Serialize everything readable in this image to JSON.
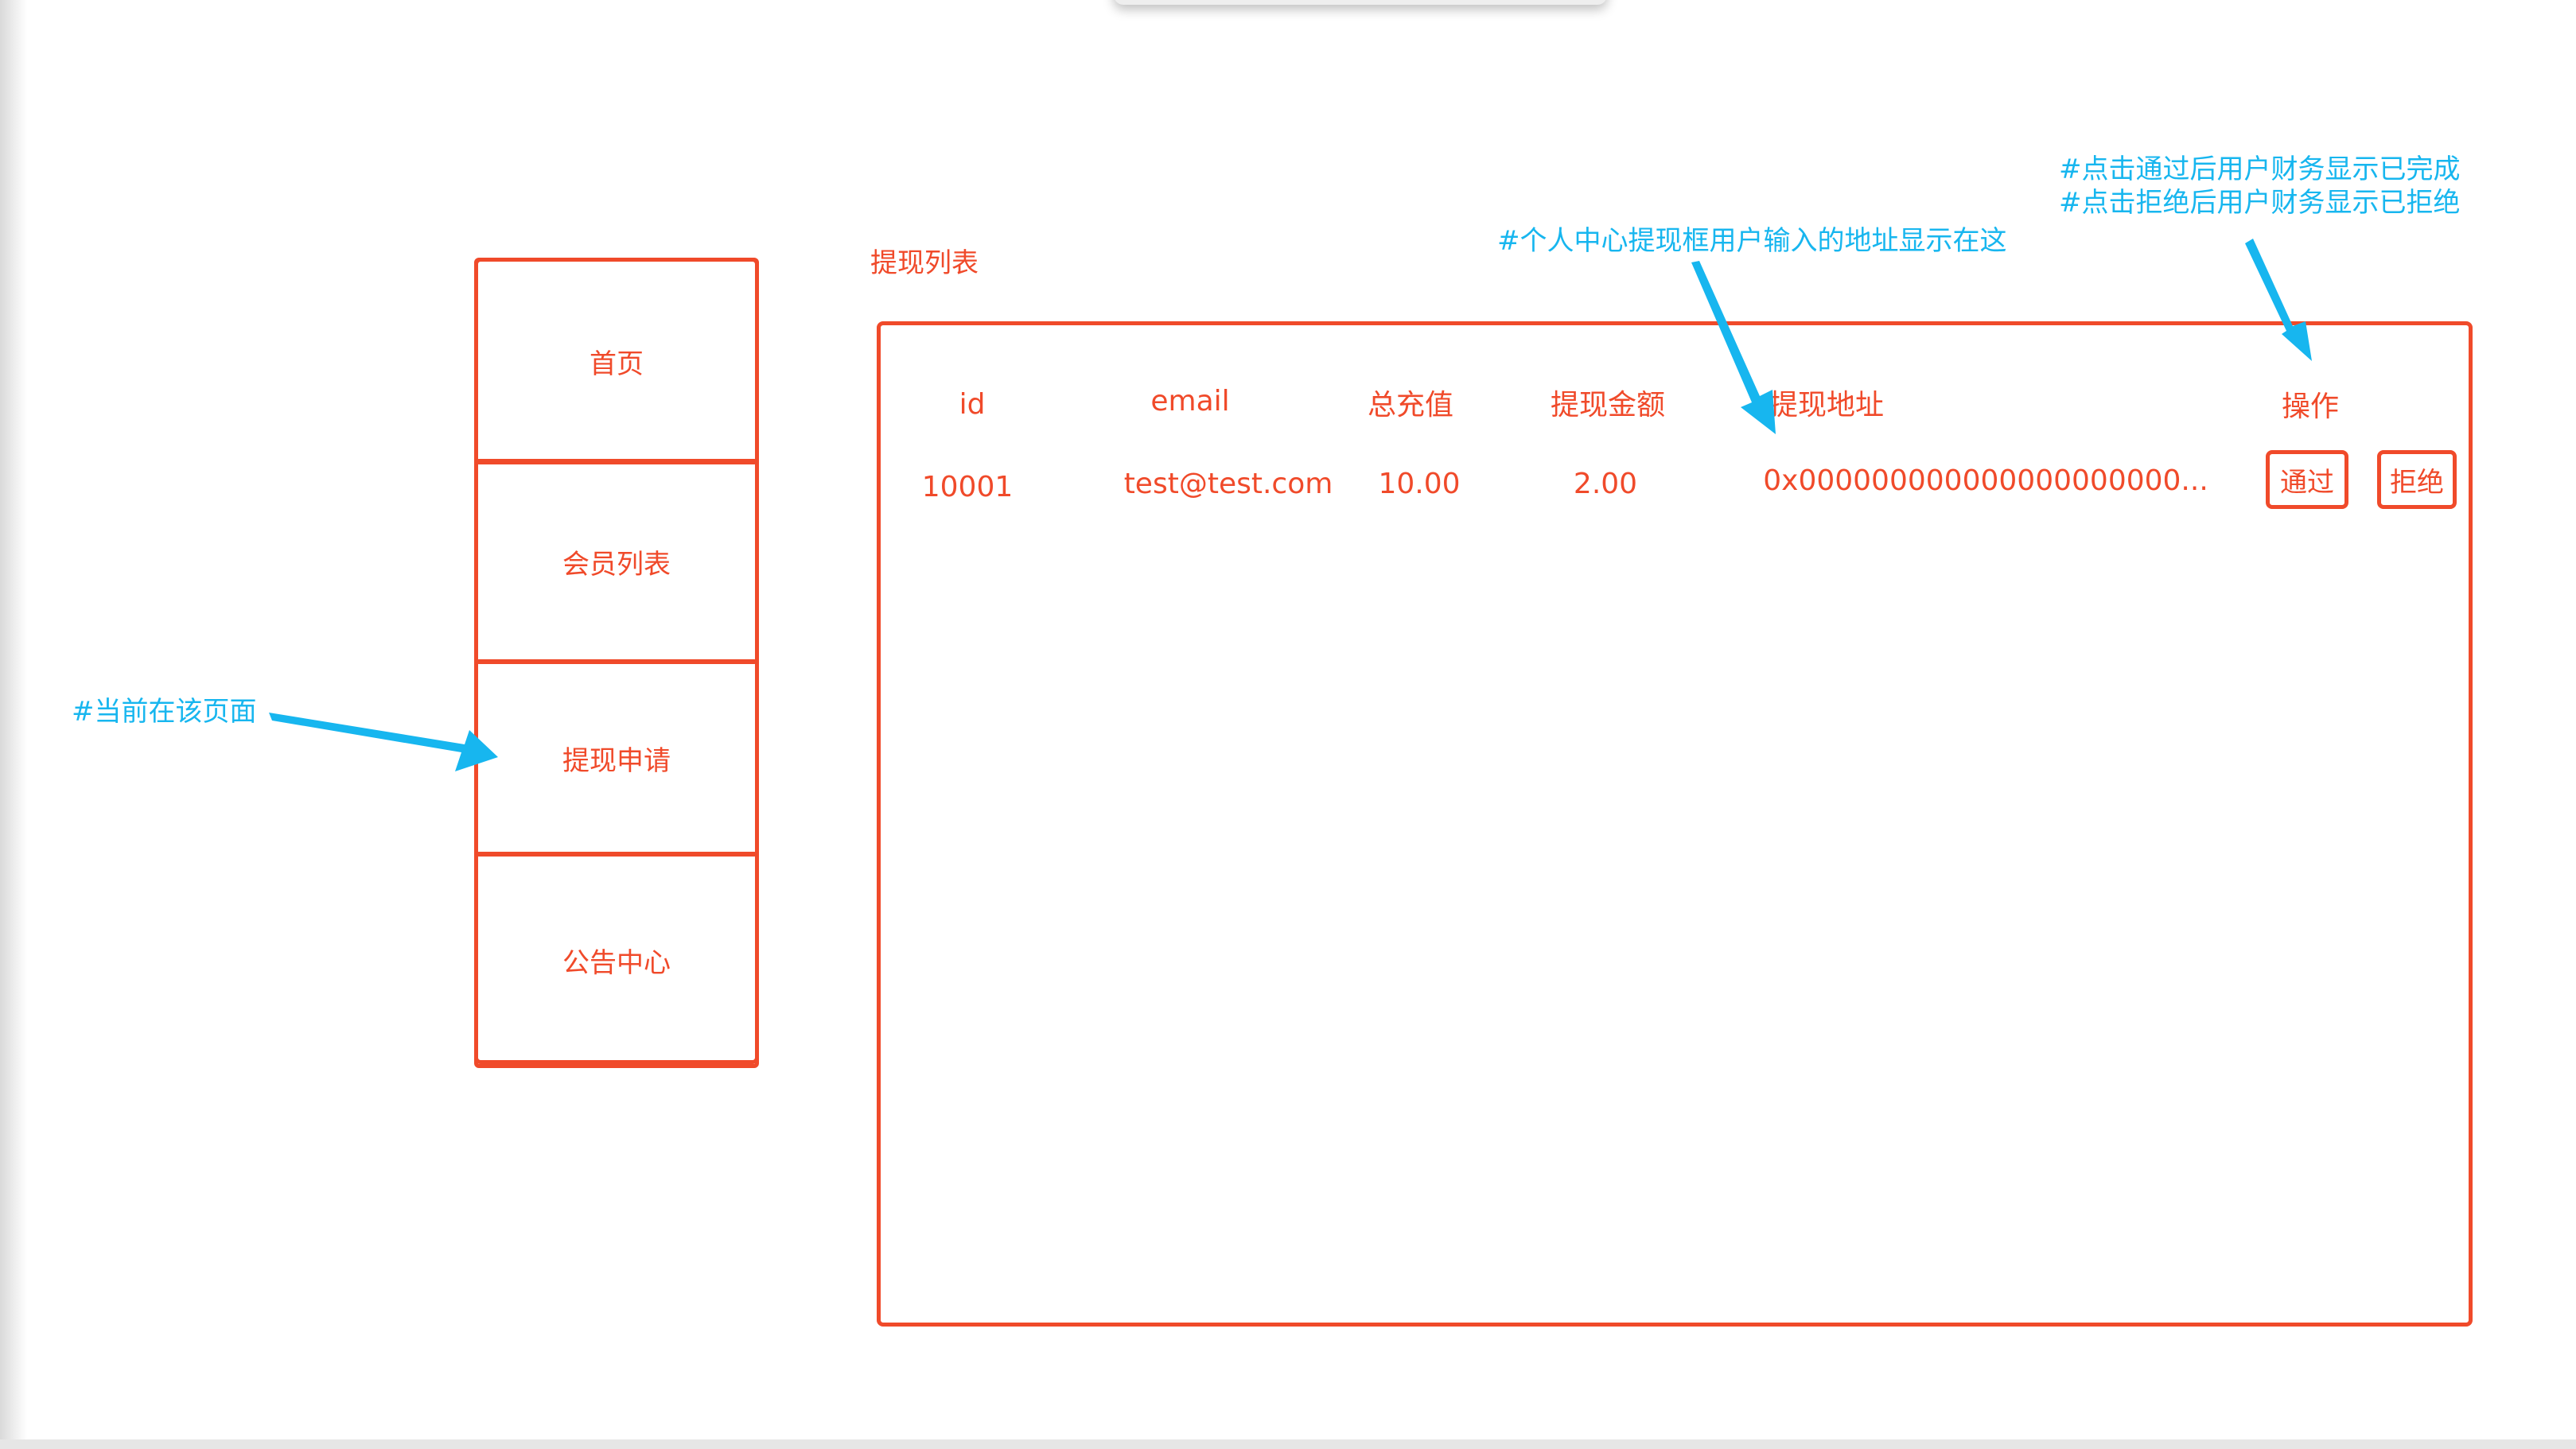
{
  "sidebar": {
    "items": [
      {
        "label": "首页"
      },
      {
        "label": "会员列表"
      },
      {
        "label": "提现申请"
      },
      {
        "label": "公告中心"
      }
    ]
  },
  "main": {
    "title": "提现列表",
    "table": {
      "headers": [
        "id",
        "email",
        "总充值",
        "提现金额",
        "提现地址",
        "操作"
      ],
      "rows": [
        {
          "id": "10001",
          "email": "test@test.com",
          "total_recharge": "10.00",
          "withdraw_amount": "2.00",
          "address": "0x000000000000000000000...",
          "approve_label": "通过",
          "reject_label": "拒绝"
        }
      ]
    }
  },
  "annotations": {
    "current_page": "#当前在该页面",
    "address_note": "#个人中心提现框用户输入的地址显示在这",
    "action_note_line1": "#点击通过后用户财务显示已完成",
    "action_note_line2": "#点击拒绝后用户财务显示已拒绝"
  },
  "colors": {
    "accent_red": "#f04a2a",
    "annotation_cyan": "#17b6ef"
  }
}
